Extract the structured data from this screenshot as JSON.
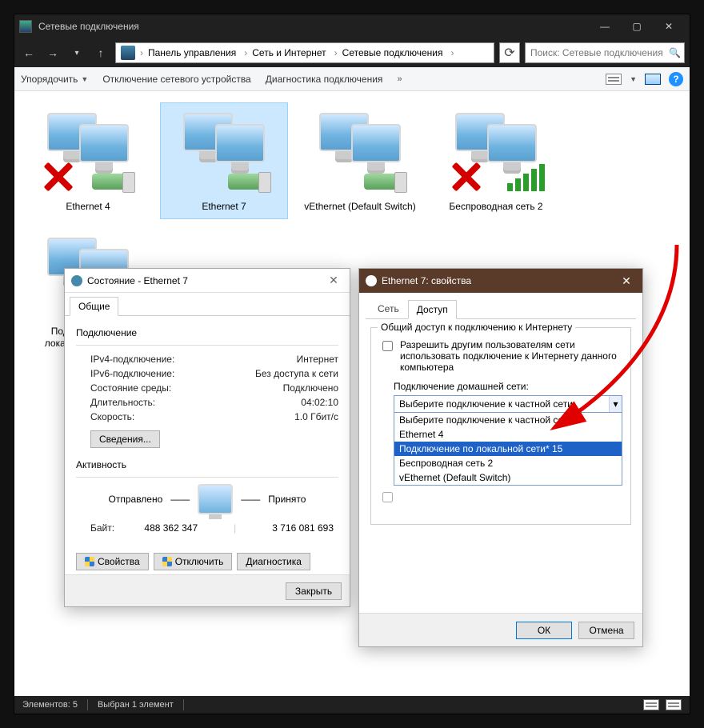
{
  "window": {
    "title": "Сетевые подключения"
  },
  "breadcrumb": {
    "a": "Панель управления",
    "b": "Сеть и Интернет",
    "c": "Сетевые подключения"
  },
  "search_placeholder": "Поиск: Сетевые подключения",
  "toolbar": {
    "organize": "Упорядочить",
    "disable": "Отключение сетевого устройства",
    "diag": "Диагностика подключения"
  },
  "items": {
    "e4": "Ethernet 4",
    "e7": "Ethernet 7",
    "veth": "vEthernet (Default Switch)",
    "wifi2": "Беспроводная сеть 2",
    "lan15": "Подключение по локальной сети* 15"
  },
  "status": {
    "title": "Состояние - Ethernet 7",
    "tab_general": "Общие",
    "section_conn": "Подключение",
    "ipv4_k": "IPv4-подключение:",
    "ipv4_v": "Интернет",
    "ipv6_k": "IPv6-подключение:",
    "ipv6_v": "Без доступа к сети",
    "media_k": "Состояние среды:",
    "media_v": "Подключено",
    "dur_k": "Длительность:",
    "dur_v": "04:02:10",
    "speed_k": "Скорость:",
    "speed_v": "1.0 Гбит/с",
    "details": "Сведения...",
    "section_act": "Активность",
    "sent": "Отправлено",
    "recv": "Принято",
    "bytes_k": "Байт:",
    "bytes_sent": "488 362 347",
    "bytes_recv": "3 716 081 693",
    "props": "Свойства",
    "disable": "Отключить",
    "diag": "Диагностика",
    "close": "Закрыть"
  },
  "props": {
    "title": "Ethernet 7: свойства",
    "tab_net": "Сеть",
    "tab_access": "Доступ",
    "group": "Общий доступ к подключению к Интернету",
    "chk1": "Разрешить другим пользователям сети использовать подключение к Интернету данного компьютера",
    "home_net": "Подключение домашней сети:",
    "combo_sel": "Выберите подключение к частной сети",
    "opt0": "Выберите подключение к частной сети",
    "opt1": "Ethernet 4",
    "opt2": "Подключение по локальной сети* 15",
    "opt3": "Беспроводная сеть 2",
    "opt4": "vEthernet (Default Switch)",
    "ok": "ОК",
    "cancel": "Отмена"
  },
  "statusbar": {
    "count": "Элементов: 5",
    "sel": "Выбран 1 элемент"
  }
}
